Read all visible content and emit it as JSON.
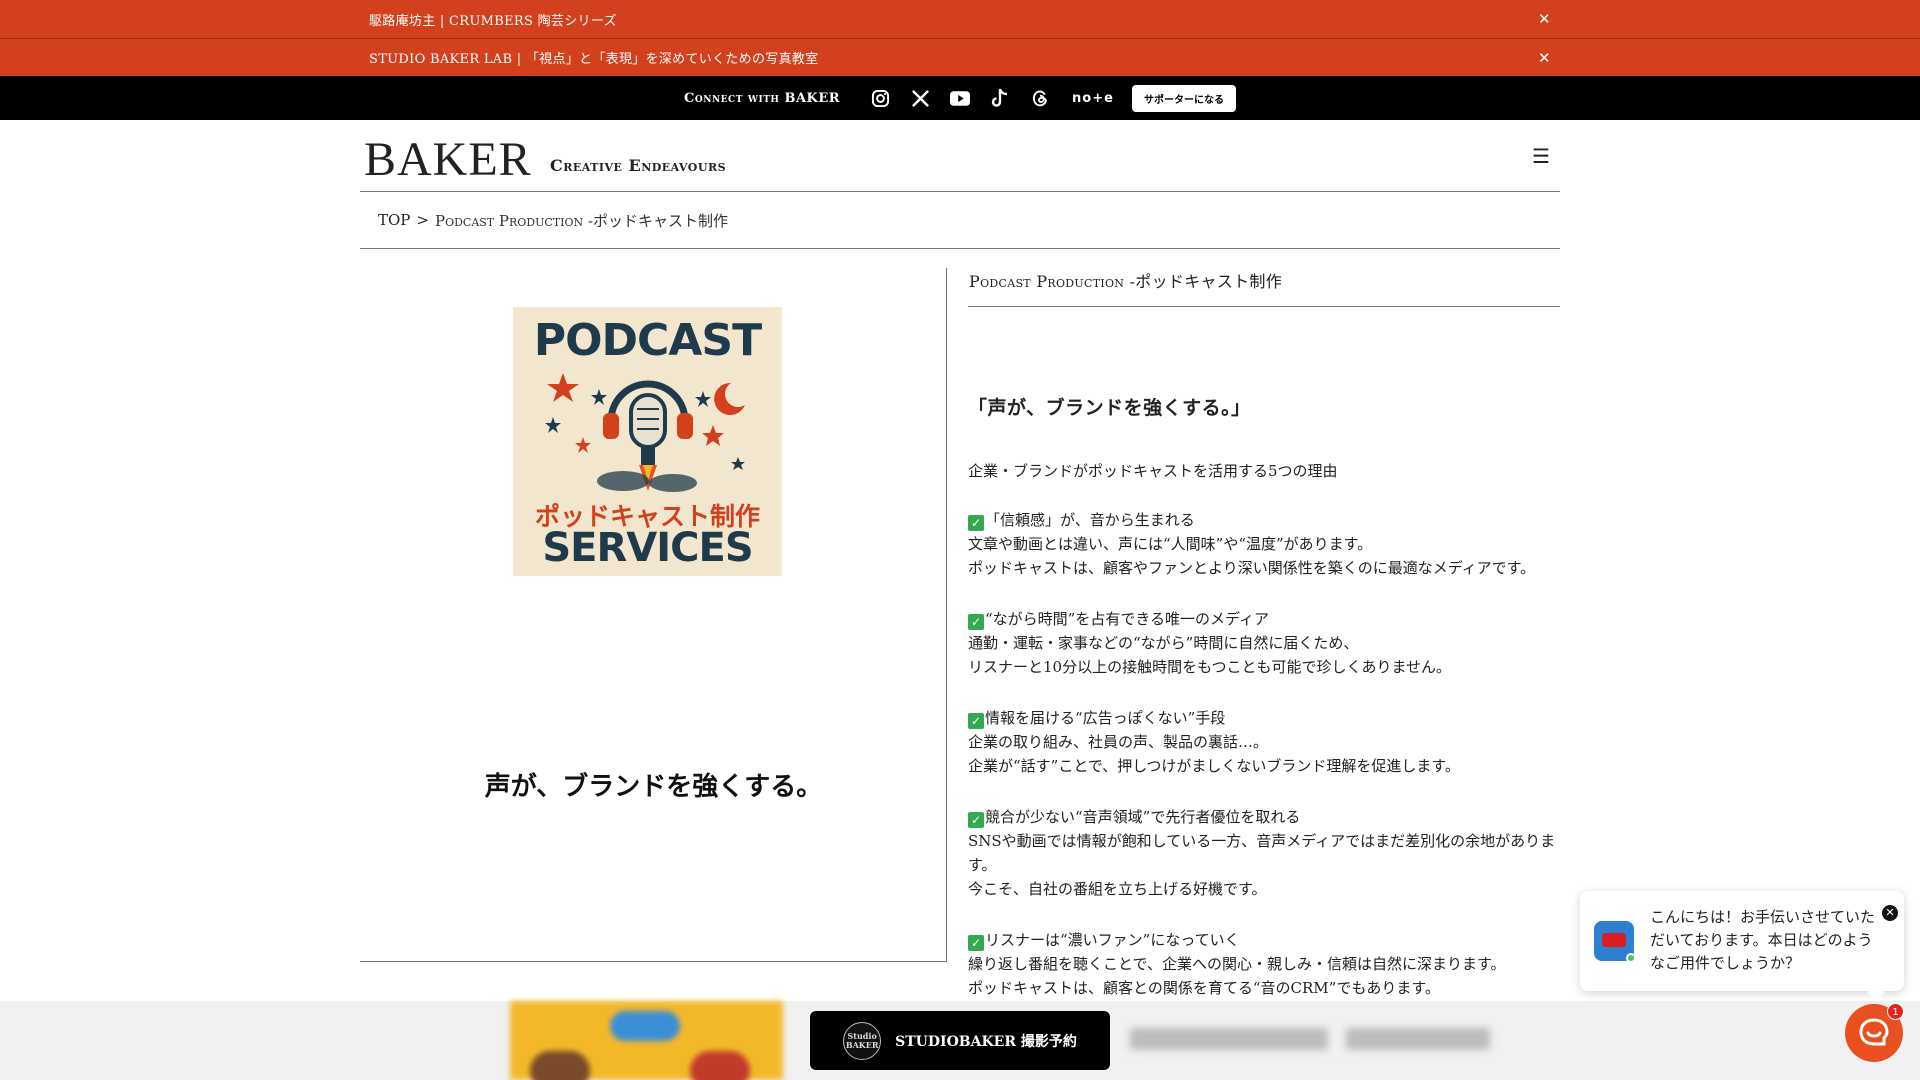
{
  "notices": [
    {
      "text": "駆路庵坊主 | CRUMBERS 陶芸シリーズ",
      "close": "✕"
    },
    {
      "text": "STUDIO BAKER LAB | 「視点」と「表現」を深めていくための写真教室",
      "close": "✕"
    }
  ],
  "connect": {
    "label": "Connect with BAKER",
    "socials": [
      "instagram-icon",
      "x-icon",
      "youtube-icon",
      "tiktok-icon",
      "threads-icon"
    ],
    "note": "no+e",
    "supporter": "サポーターになる"
  },
  "header": {
    "logo": "BAKER",
    "tagline": "Creative Endeavours",
    "menu": "☰"
  },
  "breadcrumb": {
    "top": "TOP",
    "sep": ">",
    "current": "Podcast Production -ポッドキャスト制作"
  },
  "artwork": {
    "line1": "PODCAST",
    "line2": "ポッドキャスト制作",
    "line3": "SERVICES"
  },
  "slogan": "声が、ブランドを強くする。",
  "article": {
    "title": "Podcast Production -ポッドキャスト制作",
    "headline": "「声が、ブランドを強くする。」",
    "intro": "企業・ブランドがポッドキャストを活用する5つの理由",
    "reasons": [
      {
        "heading": "「信頼感」が、音から生まれる",
        "body": "文章や動画とは違い、声には“人間味”や“温度”があります。\nポッドキャストは、顧客やファンとより深い関係性を築くのに最適なメディアです。"
      },
      {
        "heading": "“ながら時間”を占有できる唯一のメディア",
        "body": "通勤・運転・家事などの“ながら”時間に自然に届くため、\nリスナーと10分以上の接触時間をもつことも可能で珍しくありません。"
      },
      {
        "heading": "情報を届ける“広告っぽくない”手段",
        "body": "企業の取り組み、社員の声、製品の裏話…。\n企業が“話す”ことで、押しつけがましくないブランド理解を促進します。"
      },
      {
        "heading": "競合が少ない“音声領域”で先行者優位を取れる",
        "body": "SNSや動画では情報が飽和している一方、音声メディアではまだ差別化の余地があります。\n今こそ、自社の番組を立ち上げる好機です。"
      },
      {
        "heading": "リスナーは“濃いファン”になっていく",
        "body": "繰り返し番組を聴くことで、企業への関心・親しみ・信頼は自然に深まります。\nポッドキャストは、顧客との関係を育てる“音のCRM”でもあります。"
      }
    ],
    "check": "✓"
  },
  "booking": {
    "label": "STUDIOBAKER 撮影予約",
    "seal": "Studio BAKER"
  },
  "chat": {
    "message": "こんにちは！お手伝いさせていただいております。本日はどのようなご用件でしょうか？",
    "close": "✕",
    "badge": "1"
  },
  "colors": {
    "accent": "#d2401d",
    "black": "#000000",
    "check": "#35a852",
    "launcher": "#e8501f"
  }
}
